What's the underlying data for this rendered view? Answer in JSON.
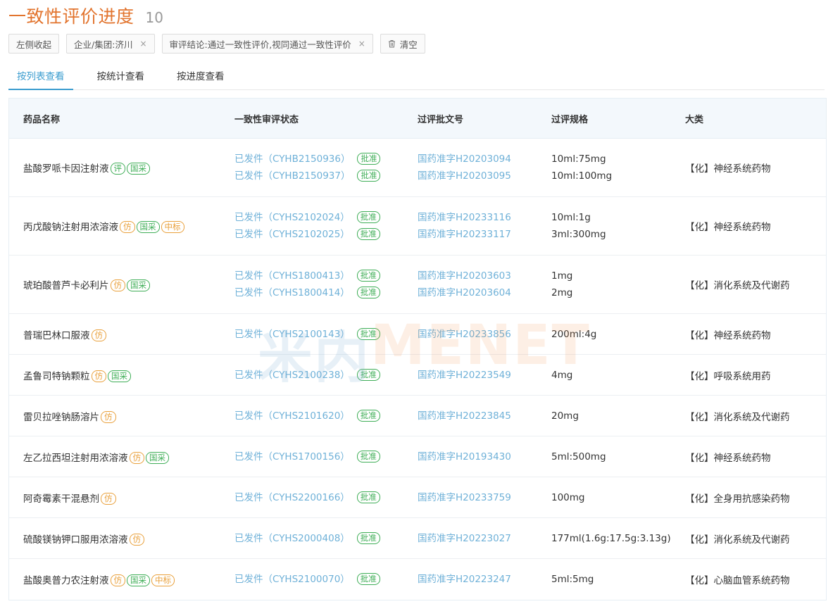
{
  "header": {
    "title": "一致性评价进度",
    "count": "10"
  },
  "filters": {
    "collapse_label": "左侧收起",
    "chip_company": "企业/集团:济川",
    "chip_conclusion": "审评结论:通过一致性评价,视同通过一致性评价",
    "clear_label": "清空",
    "remove_glyph": "×"
  },
  "tabs": [
    "按列表查看",
    "按统计查看",
    "按进度查看"
  ],
  "table": {
    "headers": [
      "药品名称",
      "一致性审评状态",
      "过评批文号",
      "过评规格",
      "大类"
    ],
    "approve_label": "批准",
    "rows": [
      {
        "name": "盐酸罗哌卡因注射液",
        "tags": [
          {
            "text": "评",
            "color": "green"
          },
          {
            "text": "国采",
            "color": "green"
          }
        ],
        "status": [
          "已发件（CYHB2150936）",
          "已发件（CYHB2150937）"
        ],
        "docs": [
          "国药准字H20203094",
          "国药准字H20203095"
        ],
        "specs": [
          "10ml:75mg",
          "10ml:100mg"
        ],
        "category": "【化】神经系统药物"
      },
      {
        "name": "丙戊酸钠注射用浓溶液",
        "tags": [
          {
            "text": "仿",
            "color": "orange"
          },
          {
            "text": "国采",
            "color": "green"
          },
          {
            "text": "中标",
            "color": "orange"
          }
        ],
        "status": [
          "已发件（CYHS2102024）",
          "已发件（CYHS2102025）"
        ],
        "docs": [
          "国药准字H20233116",
          "国药准字H20233117"
        ],
        "specs": [
          "10ml:1g",
          "3ml:300mg"
        ],
        "category": "【化】神经系统药物"
      },
      {
        "name": "琥珀酸普芦卡必利片",
        "tags": [
          {
            "text": "仿",
            "color": "orange"
          },
          {
            "text": "国采",
            "color": "green"
          }
        ],
        "status": [
          "已发件（CYHS1800413）",
          "已发件（CYHS1800414）"
        ],
        "docs": [
          "国药准字H20203603",
          "国药准字H20203604"
        ],
        "specs": [
          "1mg",
          "2mg"
        ],
        "category": "【化】消化系统及代谢药"
      },
      {
        "name": "普瑞巴林口服液",
        "tags": [
          {
            "text": "仿",
            "color": "orange"
          }
        ],
        "status": [
          "已发件（CYHS2100143）"
        ],
        "docs": [
          "国药准字H20233856"
        ],
        "specs": [
          "200ml:4g"
        ],
        "category": "【化】神经系统药物"
      },
      {
        "name": "孟鲁司特钠颗粒",
        "tags": [
          {
            "text": "仿",
            "color": "orange"
          },
          {
            "text": "国采",
            "color": "green"
          }
        ],
        "status": [
          "已发件（CYHS2100238）"
        ],
        "docs": [
          "国药准字H20223549"
        ],
        "specs": [
          "4mg"
        ],
        "category": "【化】呼吸系统用药"
      },
      {
        "name": "雷贝拉唑钠肠溶片",
        "tags": [
          {
            "text": "仿",
            "color": "orange"
          }
        ],
        "status": [
          "已发件（CYHS2101620）"
        ],
        "docs": [
          "国药准字H20223845"
        ],
        "specs": [
          "20mg"
        ],
        "category": "【化】消化系统及代谢药"
      },
      {
        "name": "左乙拉西坦注射用浓溶液",
        "tags": [
          {
            "text": "仿",
            "color": "orange"
          },
          {
            "text": "国采",
            "color": "green"
          }
        ],
        "status": [
          "已发件（CYHS1700156）"
        ],
        "docs": [
          "国药准字H20193430"
        ],
        "specs": [
          "5ml:500mg"
        ],
        "category": "【化】神经系统药物"
      },
      {
        "name": "阿奇霉素干混悬剂",
        "tags": [
          {
            "text": "仿",
            "color": "orange"
          }
        ],
        "status": [
          "已发件（CYHS2200166）"
        ],
        "docs": [
          "国药准字H20233759"
        ],
        "specs": [
          "100mg"
        ],
        "category": "【化】全身用抗感染药物"
      },
      {
        "name": "硫酸镁钠钾口服用浓溶液",
        "tags": [
          {
            "text": "仿",
            "color": "orange"
          }
        ],
        "status": [
          "已发件（CYHS2000408）"
        ],
        "docs": [
          "国药准字H20223027"
        ],
        "specs": [
          "177ml(1.6g:17.5g:3.13g)"
        ],
        "category": "【化】消化系统及代谢药"
      },
      {
        "name": "盐酸奥普力农注射液",
        "tags": [
          {
            "text": "仿",
            "color": "orange"
          },
          {
            "text": "国采",
            "color": "green"
          },
          {
            "text": "中标",
            "color": "orange"
          }
        ],
        "status": [
          "已发件（CYHS2100070）"
        ],
        "docs": [
          "国药准字H20223247"
        ],
        "specs": [
          "5ml:5mg"
        ],
        "category": "【化】心脑血管系统药物"
      }
    ]
  },
  "watermark": {
    "part_a": "米内",
    "part_b": "MENET"
  },
  "colors": {
    "accent": "#3a9ccf",
    "title": "#e2742e",
    "tag_green": "#3fae57",
    "tag_orange": "#e9a03b",
    "link": "#6fb1d8"
  }
}
